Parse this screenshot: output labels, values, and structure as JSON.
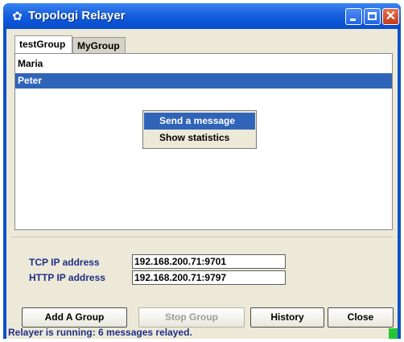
{
  "window": {
    "title": "Topologi Relayer",
    "icon": "app-icon"
  },
  "tabs": [
    {
      "label": "testGroup",
      "active": true
    },
    {
      "label": "MyGroup",
      "active": false
    }
  ],
  "members": [
    {
      "name": "Maria",
      "selected": false
    },
    {
      "name": "Peter",
      "selected": true
    }
  ],
  "context_menu": {
    "items": [
      {
        "label": "Send a message",
        "highlighted": true
      },
      {
        "label": "Show statistics",
        "highlighted": false
      }
    ]
  },
  "network": {
    "tcp_label": "TCP IP address",
    "tcp_value": "192.168.200.71:9701",
    "http_label": "HTTP IP address",
    "http_value": "192.168.200.71:9797"
  },
  "buttons": {
    "add_group": "Add A Group",
    "stop_group": "Stop Group",
    "history": "History",
    "close": "Close"
  },
  "status": {
    "text": "Relayer is running: 6 messages relayed.",
    "indicator_color": "#27c535"
  },
  "colors": {
    "titlebar": "#0b54d8",
    "selection": "#2f64b8",
    "label_text": "#1f2f87"
  }
}
